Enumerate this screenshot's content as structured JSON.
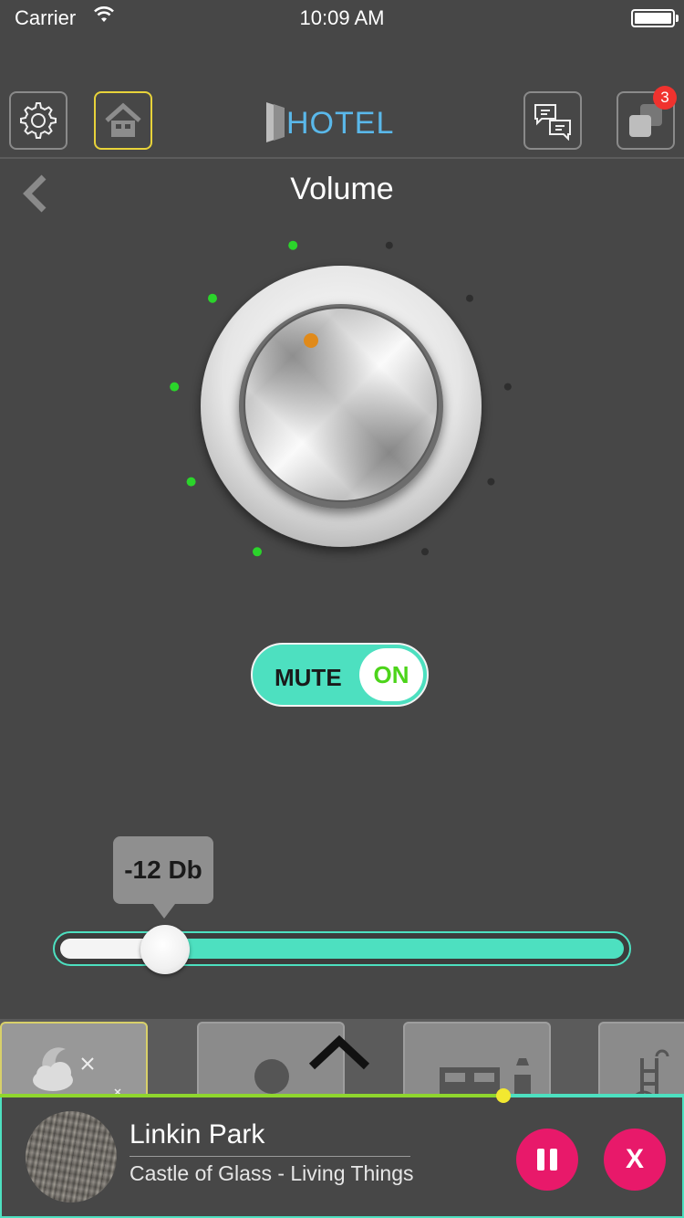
{
  "status_bar": {
    "carrier": "Carrier",
    "time": "10:09 AM"
  },
  "header": {
    "logo_text": "HOTEL",
    "notification_count": "3",
    "icons": [
      "gear-icon",
      "home-icon",
      "chat-icon",
      "apps-icon"
    ],
    "colors": {
      "active_border": "#e8d33a",
      "logo": "#5ab8ea",
      "badge": "#f0322e"
    }
  },
  "page": {
    "title": "Volume",
    "back_icon": "chevron-left-icon"
  },
  "volume_knob": {
    "led_count": 10,
    "leds_lit": 5,
    "lit_color": "#2bd42b",
    "unlit_color": "#2e2e2e",
    "indicator_color": "#e08a1a"
  },
  "mute": {
    "label": "MUTE",
    "state": "ON"
  },
  "slider": {
    "value_label": "-12 Db",
    "fraction": 0.19,
    "fill_color": "#4de0c0"
  },
  "scenes": {
    "icons": [
      "night-scene-icon",
      "circle-scene-icon",
      "bedroom-scene-icon",
      "pool-scene-icon"
    ],
    "expand_icon": "chevron-up-icon"
  },
  "now_playing": {
    "artist": "Linkin Park",
    "track": "Castle of Glass - Living Things",
    "progress": 0.736,
    "pause_icon": "pause-icon",
    "close_label": "X",
    "button_color": "#e8196a"
  }
}
